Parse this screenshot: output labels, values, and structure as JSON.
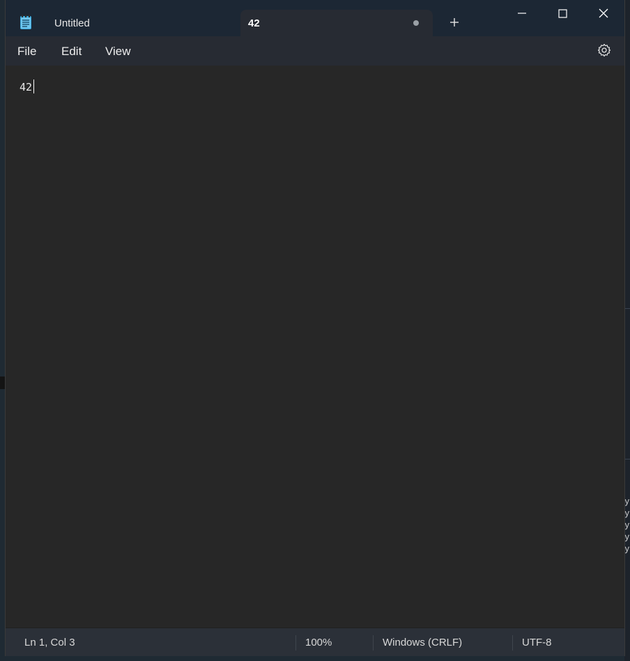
{
  "window": {
    "tabs": [
      {
        "label": "Untitled"
      },
      {
        "label": "42",
        "modified": true
      }
    ],
    "active_tab_index": 1
  },
  "menu": {
    "items": [
      "File",
      "Edit",
      "View"
    ]
  },
  "editor": {
    "text": "42"
  },
  "status": {
    "position": "Ln 1, Col 3",
    "zoom": "100%",
    "line_endings": "Windows (CRLF)",
    "encoding": "UTF-8"
  },
  "background": {
    "right_edge_letters": [
      "y",
      "y",
      "y",
      "y",
      "y"
    ]
  },
  "colors": {
    "titlebar": "#1c2734",
    "active_tab": "#272b33",
    "editor_bg": "#272727",
    "statusbar": "#2b3038"
  },
  "icons": {
    "app": "notepad-icon",
    "new_tab": "plus-icon",
    "minimize": "minimize-icon",
    "maximize": "maximize-icon",
    "close": "close-icon",
    "settings": "gear-icon"
  }
}
